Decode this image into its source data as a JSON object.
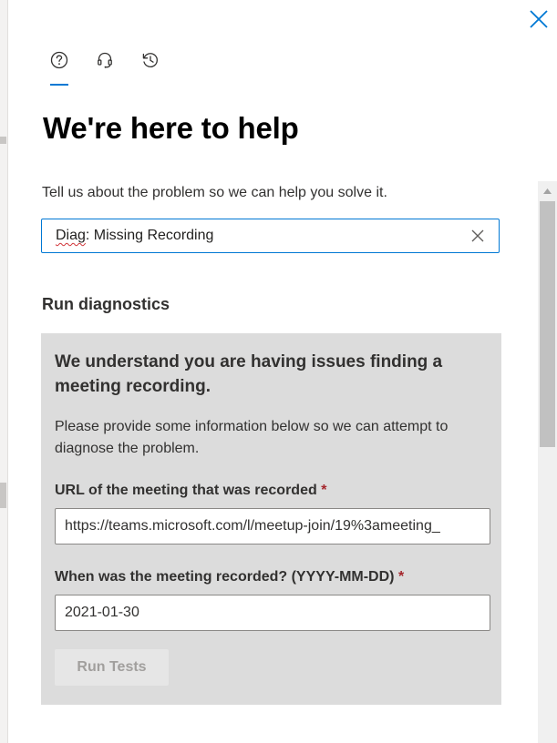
{
  "panel": {
    "title": "We're here to help",
    "description": "Tell us about the problem so we can help you solve it."
  },
  "tabs": [
    {
      "name": "help",
      "icon": "question-circle-icon",
      "active": true
    },
    {
      "name": "contact",
      "icon": "headset-icon",
      "active": false
    },
    {
      "name": "history",
      "icon": "history-icon",
      "active": false
    }
  ],
  "search": {
    "value_prefix": "Diag",
    "value_rest": ": Missing Recording"
  },
  "diagnostics": {
    "section_title": "Run diagnostics",
    "heading": "We understand you are having issues finding a meeting recording.",
    "text": "Please provide some information below so we can attempt to diagnose the problem.",
    "url_label": "URL of the meeting that was recorded",
    "url_value": "https://teams.microsoft.com/l/meetup-join/19%3ameeting_",
    "date_label": "When was the meeting recorded? (YYYY-MM-DD)",
    "date_value": "2021-01-30",
    "required_mark": "*",
    "run_button": "Run Tests"
  },
  "colors": {
    "accent": "#0078d4",
    "required": "#a4262c",
    "panel_bg": "#dcdcdc"
  }
}
